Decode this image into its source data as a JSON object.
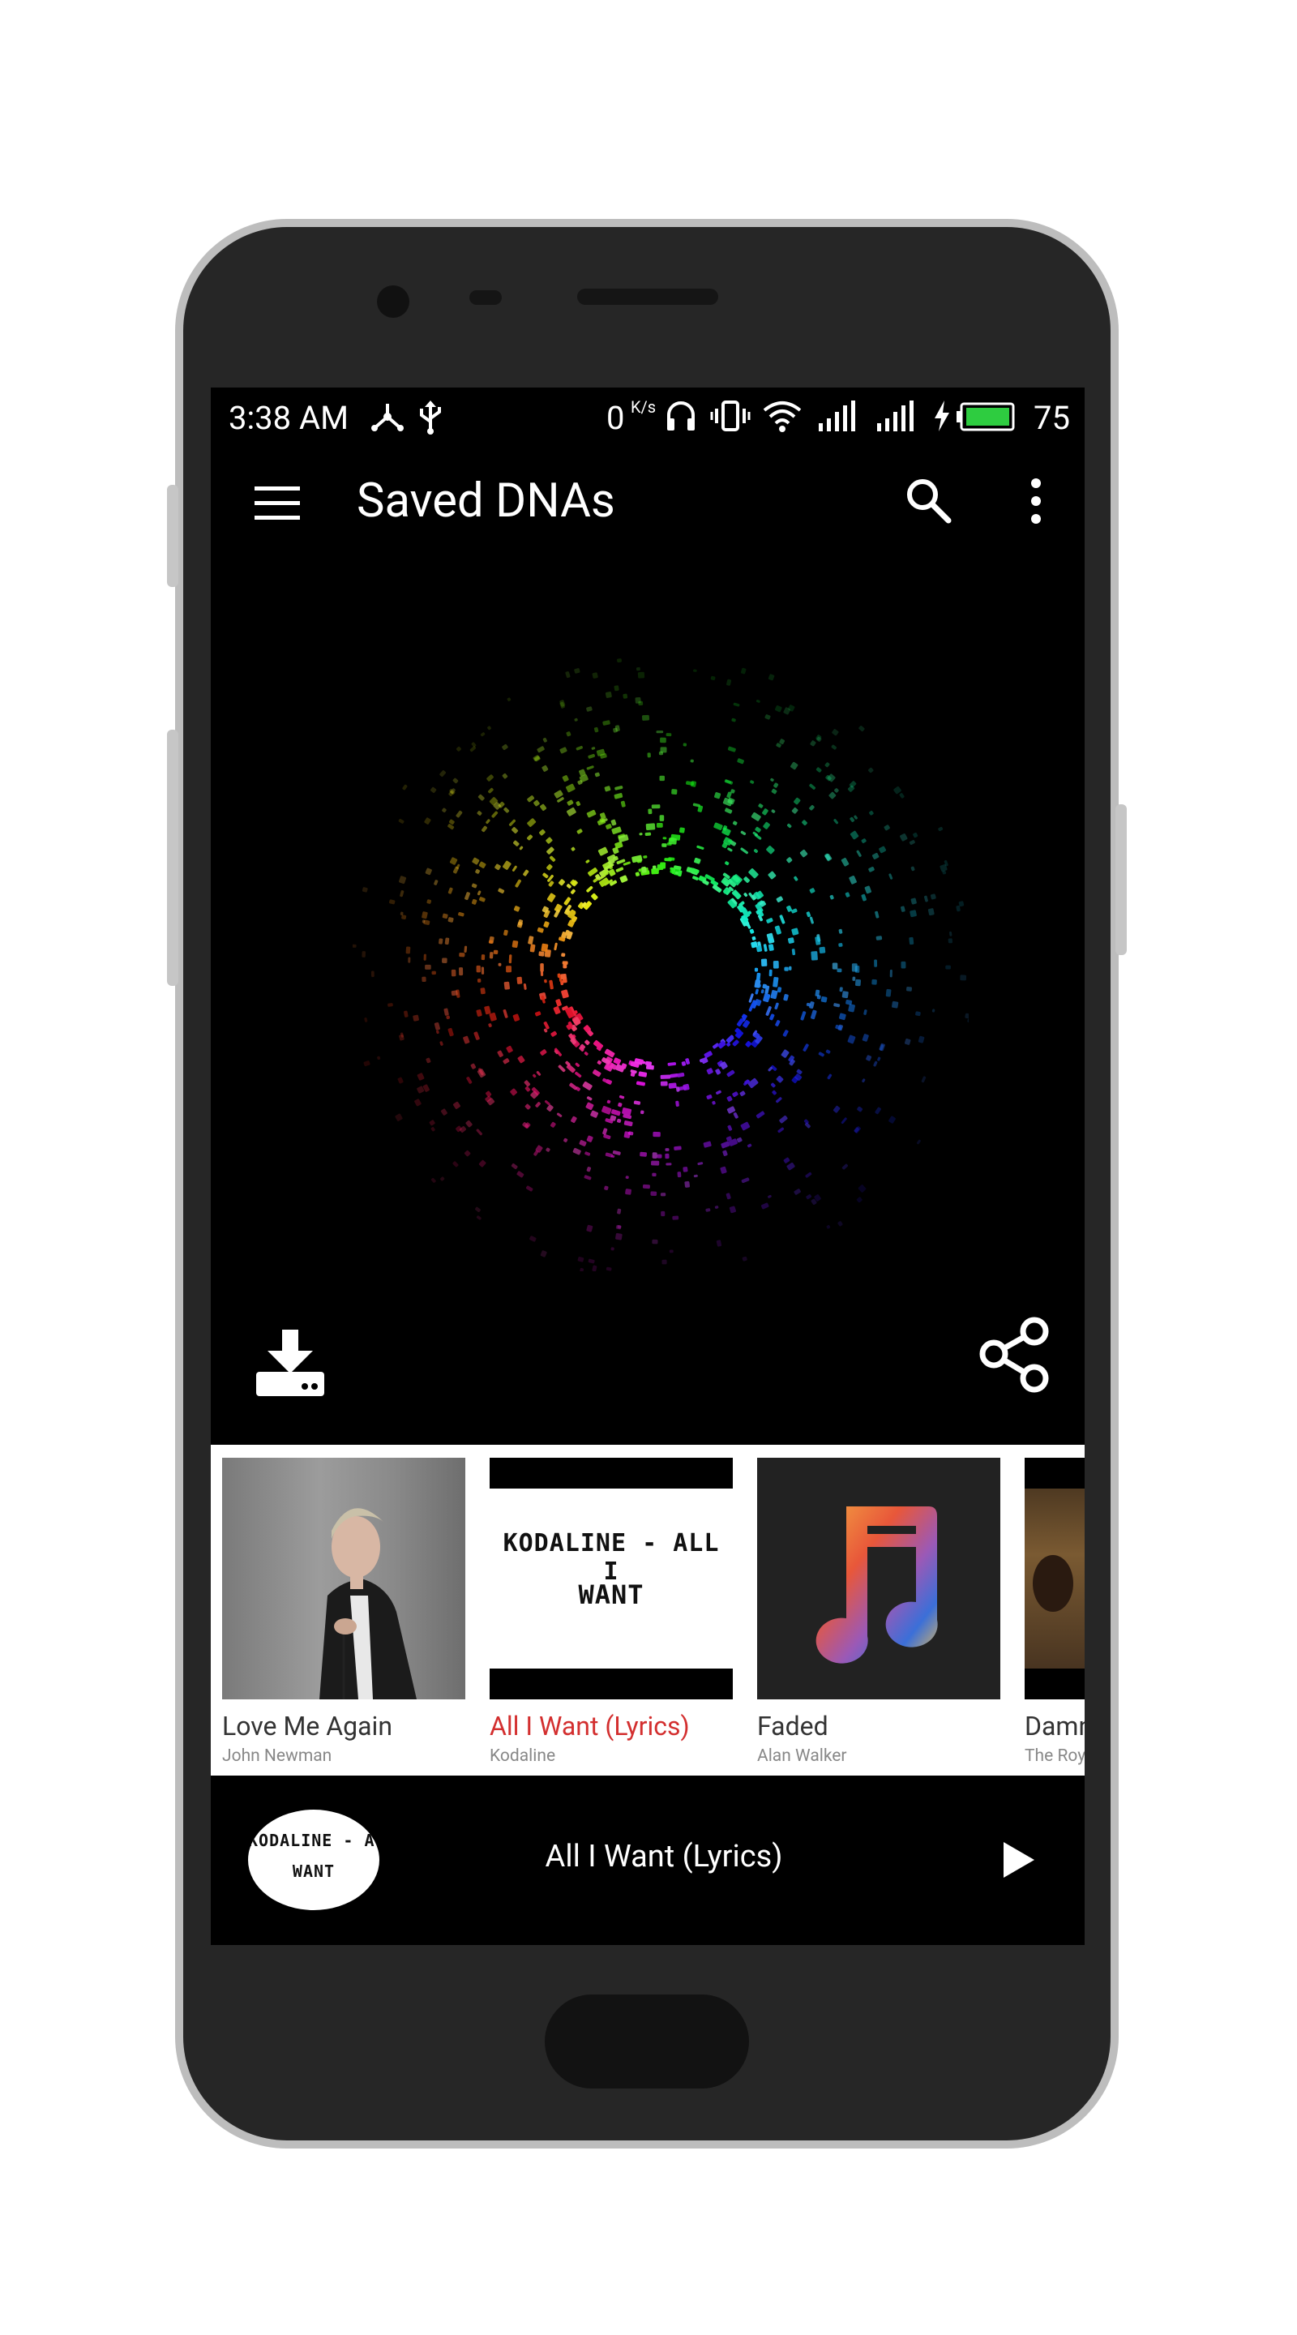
{
  "status_bar": {
    "time": "3:38 AM",
    "data_speed": "0",
    "data_unit": "K/s",
    "battery_level": "75",
    "icons": [
      "network-share-icon",
      "usb-icon",
      "headphones-icon",
      "vibrate-icon",
      "wifi-icon",
      "signal-icon",
      "signal-icon",
      "charging-icon",
      "battery-icon"
    ]
  },
  "app_bar": {
    "title": "Saved DNAs",
    "menu_icon": "hamburger-menu-icon",
    "search_icon": "search-icon",
    "more_icon": "more-vert-icon"
  },
  "visualization": {
    "type": "song-dna-ring",
    "actions": {
      "download_icon": "download-icon",
      "share_icon": "share-icon"
    }
  },
  "saved_songs": [
    {
      "title": "Love Me Again",
      "artist": "John Newman",
      "active": false
    },
    {
      "title": "All I Want (Lyrics)",
      "artist": "Kodaline",
      "active": true,
      "thumb_text_1": "KODALINE - ALL I",
      "thumb_text_2": "WANT"
    },
    {
      "title": "Faded",
      "artist": "Alan Walker",
      "active": false
    },
    {
      "title": "Damn",
      "artist": "The Roy",
      "active": false
    }
  ],
  "now_playing": {
    "title": "All I Want (Lyrics)",
    "art_text_1": "KODALINE - ALL I",
    "art_text_2": "WANT",
    "play_icon": "play-icon"
  },
  "colors": {
    "accent_active": "#d32f2f",
    "screen_background": "#000000",
    "strip_background": "#ffffff"
  }
}
